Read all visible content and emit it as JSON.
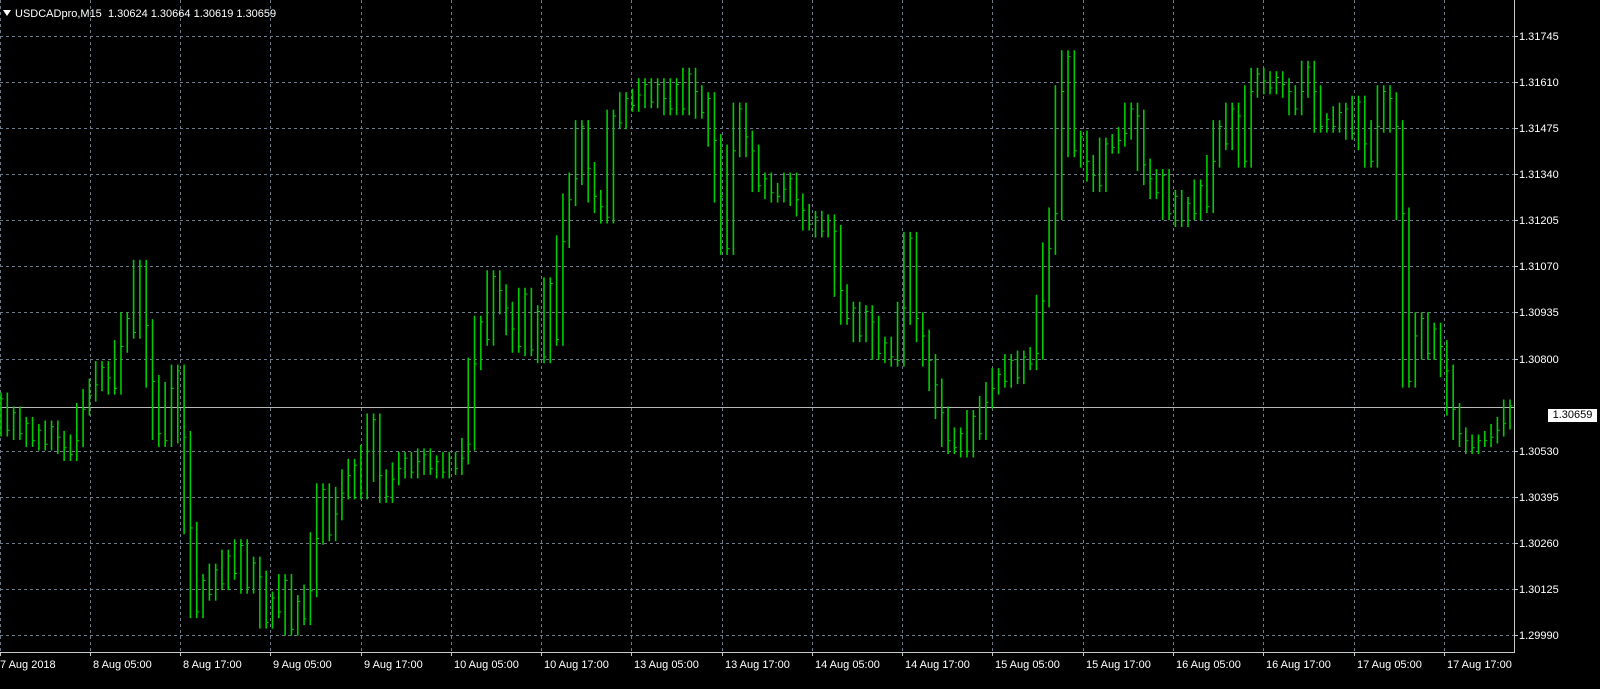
{
  "header": {
    "symbol_timeframe": "USDCADpro,M15",
    "ohlc": "1.30624 1.30664 1.30619 1.30659"
  },
  "price_axis": {
    "labels": [
      "1.31745",
      "1.31610",
      "1.31475",
      "1.31340",
      "1.31205",
      "1.31070",
      "1.30935",
      "1.30800",
      "1.30530",
      "1.30395",
      "1.30260",
      "1.30125",
      "1.29990"
    ],
    "current_price": "1.30659"
  },
  "time_axis": {
    "labels": [
      "7 Aug 2018",
      "8 Aug 05:00",
      "8 Aug 17:00",
      "9 Aug 05:00",
      "9 Aug 17:00",
      "10 Aug 05:00",
      "10 Aug 17:00",
      "13 Aug 05:00",
      "13 Aug 17:00",
      "14 Aug 05:00",
      "14 Aug 17:00",
      "15 Aug 05:00",
      "15 Aug 17:00",
      "16 Aug 05:00",
      "16 Aug 17:00",
      "17 Aug 05:00",
      "17 Aug 17:00"
    ]
  },
  "colors": {
    "background": "#000000",
    "candles": "#00cc00",
    "grid": "#6c7a8a",
    "text": "#ffffff"
  },
  "chart_data": {
    "type": "line",
    "series": [
      {
        "values": [
          1.3067,
          1.3058,
          1.3063,
          1.3057,
          1.306,
          1.3055,
          1.3058,
          1.3054,
          1.3059,
          1.3056,
          1.3053,
          1.3051,
          1.3055,
          1.3064,
          1.3068,
          1.3071,
          1.3076,
          1.3073,
          1.307,
          1.3082,
          1.309,
          1.3086,
          1.3105,
          1.3088,
          1.3072,
          1.3057,
          1.3055,
          1.307,
          1.3075,
          1.3056,
          1.303,
          1.3006,
          1.3015,
          1.3011,
          1.3018,
          1.3014,
          1.3022,
          1.3017,
          1.3025,
          1.3013,
          1.302,
          1.3016,
          1.3003,
          1.301,
          1.3006,
          1.3015,
          1.3001,
          1.3009,
          1.3004,
          1.3012,
          1.3027,
          1.3041,
          1.3028,
          1.3034,
          1.304,
          1.3045,
          1.3048,
          1.304,
          1.3052,
          1.3061,
          1.3045,
          1.3039,
          1.3044,
          1.3047,
          1.305,
          1.3046,
          1.3049,
          1.3051,
          1.3047,
          1.3049,
          1.3046,
          1.305,
          1.3047,
          1.305,
          1.3054,
          1.3077,
          1.3089,
          1.3084,
          1.3102,
          1.3098,
          1.3093,
          1.3087,
          1.3082,
          1.3097,
          1.3081,
          1.3092,
          1.3079,
          1.31,
          1.3084,
          1.3112,
          1.3124,
          1.313,
          1.3145,
          1.3133,
          1.3125,
          1.3122,
          1.3119,
          1.3148,
          1.3146,
          1.3153,
          1.3151,
          1.3154,
          1.3157,
          1.3152,
          1.3157,
          1.3153,
          1.315,
          1.3157,
          1.315,
          1.316,
          1.3155,
          1.3149,
          1.3153,
          1.3141,
          1.3125,
          1.311,
          1.3138,
          1.315,
          1.3142,
          1.3138,
          1.3128,
          1.313,
          1.3126,
          1.3125,
          1.3127,
          1.313,
          1.3124,
          1.3121,
          1.3117,
          1.3119,
          1.3115,
          1.3118,
          1.3115,
          1.3098,
          1.309,
          1.3093,
          1.3085,
          1.3092,
          1.3089,
          1.308,
          1.3083,
          1.3079,
          1.3078,
          1.3093,
          1.3113,
          1.309,
          1.3085,
          1.3078,
          1.3071,
          1.3063,
          1.3055,
          1.3053,
          1.3057,
          1.3052,
          1.3062,
          1.3057,
          1.3066,
          1.307,
          1.3074,
          1.3072,
          1.3078,
          1.3073,
          1.3079,
          1.3077,
          1.308,
          1.3095,
          1.311,
          1.312,
          1.3155,
          1.3165,
          1.3138,
          1.3142,
          1.3135,
          1.3131,
          1.3128,
          1.314,
          1.3139,
          1.3141,
          1.3143,
          1.315,
          1.3148,
          1.3134,
          1.313,
          1.3126,
          1.3131,
          1.312,
          1.3125,
          1.3118,
          1.3123,
          1.312,
          1.3128,
          1.3122,
          1.3135,
          1.3145,
          1.314,
          1.315,
          1.3148,
          1.3135,
          1.3155,
          1.316,
          1.3158,
          1.3156,
          1.3159,
          1.3157,
          1.3155,
          1.315,
          1.3155,
          1.3162,
          1.3155,
          1.3145,
          1.3147,
          1.3145,
          1.3149,
          1.315,
          1.3143,
          1.3152,
          1.314,
          1.3135,
          1.3145,
          1.3155,
          1.3153,
          1.3145,
          1.312,
          1.3072,
          1.3085,
          1.309,
          1.308,
          1.3087,
          1.3082,
          1.3075,
          1.3064,
          1.3057,
          1.3055,
          1.3053,
          1.3055,
          1.3055,
          1.3056,
          1.3058,
          1.306,
          1.3065
        ]
      }
    ],
    "ylim": [
      1.29945,
      1.31812
    ]
  }
}
